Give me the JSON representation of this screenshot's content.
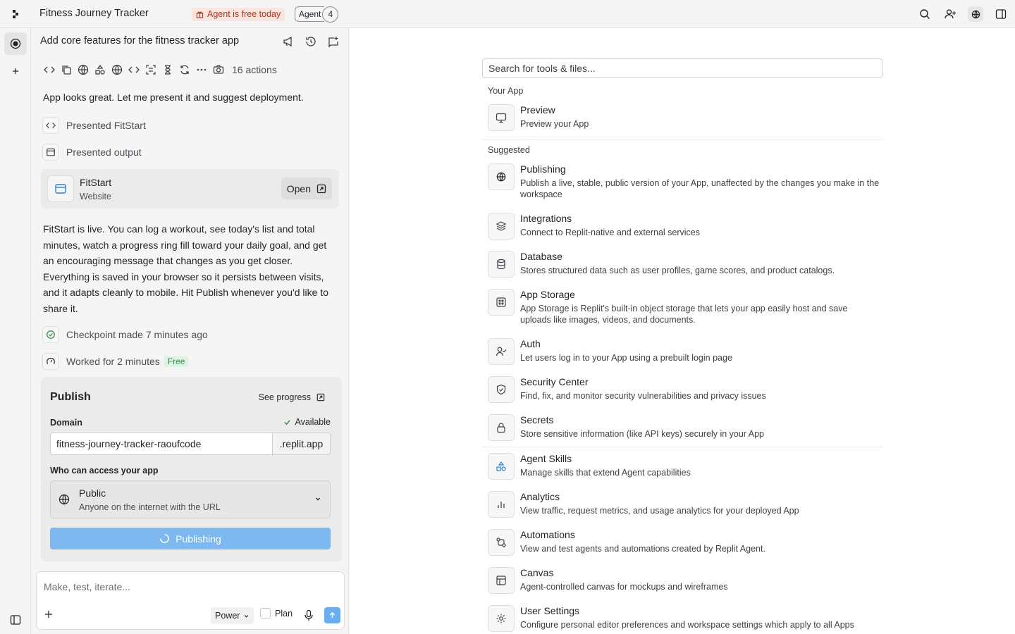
{
  "topbar": {
    "title": "Fitness Journey Tracker",
    "free_badge": "Agent is free today",
    "agent_label": "Agent",
    "agent_count": "4"
  },
  "chat": {
    "header": "Add core features for the fitness tracker app",
    "actions_count": "16 actions",
    "msg1": "App looks great. Let me present it and suggest deployment.",
    "step_presented_app": "Presented FitStart",
    "step_presented_output": "Presented output",
    "output_card": {
      "name": "FitStart",
      "type": "Website",
      "open_label": "Open"
    },
    "msg2": "FitStart is live. You can log a workout, see today's list and total minutes, watch a progress ring fill toward your daily goal, and get an encouraging message that changes as you get closer. Everything is saved in your browser so it persists between visits, and it adapts cleanly to mobile. Hit Publish whenever you'd like to share it.",
    "checkpoint": "Checkpoint made 7 minutes ago",
    "worked": "Worked for 2 minutes",
    "free_tag": "Free"
  },
  "publish": {
    "title": "Publish",
    "see_progress": "See progress",
    "domain_label": "Domain",
    "available": "Available",
    "domain_value": "fitness-journey-tracker-raoufcode",
    "domain_suffix": ".replit.app",
    "access_label": "Who can access your app",
    "access_title": "Public",
    "access_sub": "Anyone on the internet with the URL",
    "button": "Publishing"
  },
  "composer": {
    "placeholder": "Make, test, iterate...",
    "mode": "Power",
    "plan": "Plan"
  },
  "tools": {
    "search_placeholder": "Search for tools & files...",
    "your_app_label": "Your App",
    "suggested_label": "Suggested",
    "preview": {
      "name": "Preview",
      "desc": "Preview your App",
      "icon": "monitor-icon"
    },
    "items": [
      {
        "name": "Publishing",
        "desc": "Publish a live, stable, public version of your App, unaffected by the changes you make in the workspace",
        "icon": "globe-icon"
      },
      {
        "name": "Integrations",
        "desc": "Connect to Replit-native and external services",
        "icon": "layers-icon"
      },
      {
        "name": "Database",
        "desc": "Stores structured data such as user profiles, game scores, and product catalogs.",
        "icon": "database-icon"
      },
      {
        "name": "App Storage",
        "desc": "App Storage is Replit's built-in object storage that lets your app easily host and save uploads like images, videos, and documents.",
        "icon": "storage-icon"
      },
      {
        "name": "Auth",
        "desc": "Let users log in to your App using a prebuilt login page",
        "icon": "user-check-icon"
      },
      {
        "name": "Security Center",
        "desc": "Find, fix, and monitor security vulnerabilities and privacy issues",
        "icon": "shield-icon"
      },
      {
        "name": "Secrets",
        "desc": "Store sensitive information (like API keys) securely in your App",
        "icon": "lock-icon"
      },
      {
        "name": "Agent Skills",
        "desc": "Manage skills that extend Agent capabilities",
        "icon": "shapes-icon"
      },
      {
        "name": "Analytics",
        "desc": "View traffic, request metrics, and usage analytics for your deployed App",
        "icon": "bar-chart-icon"
      },
      {
        "name": "Automations",
        "desc": "View and test agents and automations created by Replit Agent.",
        "icon": "automation-icon"
      },
      {
        "name": "Canvas",
        "desc": "Agent-controlled canvas for mockups and wireframes",
        "icon": "canvas-icon"
      },
      {
        "name": "User Settings",
        "desc": "Configure personal editor preferences and workspace settings which apply to all Apps",
        "icon": "gear-icon"
      }
    ]
  },
  "colors": {
    "accent": "#7db8f0",
    "send": "#6aaef0",
    "free_badge_bg": "#fbe4de",
    "free_badge_fg": "#b1361a",
    "free_tag_fg": "#2e8b46"
  }
}
